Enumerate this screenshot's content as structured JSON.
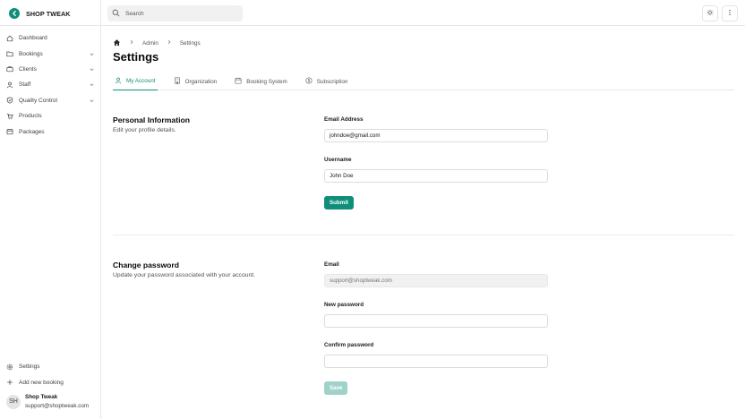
{
  "brand": {
    "name": "SHOP TWEAK"
  },
  "sidebar": {
    "items": [
      {
        "label": "Dashboard",
        "icon": "home-icon",
        "expandable": false
      },
      {
        "label": "Bookings",
        "icon": "folder-icon",
        "expandable": true
      },
      {
        "label": "Clients",
        "icon": "briefcase-icon",
        "expandable": true
      },
      {
        "label": "Staff",
        "icon": "user-icon",
        "expandable": true
      },
      {
        "label": "Quality Control",
        "icon": "shield-icon",
        "expandable": true
      },
      {
        "label": "Products",
        "icon": "cart-icon",
        "expandable": false
      },
      {
        "label": "Packages",
        "icon": "package-icon",
        "expandable": false
      }
    ],
    "bottom": [
      {
        "label": "Settings",
        "icon": "gear-icon"
      },
      {
        "label": "Add new booking",
        "icon": "plus-icon"
      }
    ],
    "user": {
      "initials": "SH",
      "name": "Shop Tweak",
      "email": "support@shoptweak.com"
    }
  },
  "topbar": {
    "search_placeholder": "Search",
    "theme_icon": "sun-icon",
    "more_icon": "kebab-icon"
  },
  "breadcrumb": [
    "Admin",
    "Settings"
  ],
  "page_title": "Settings",
  "tabs": [
    {
      "label": "My Account",
      "icon": "user-icon",
      "active": true
    },
    {
      "label": "Organization",
      "icon": "building-icon",
      "active": false
    },
    {
      "label": "Booking System",
      "icon": "calendar-icon",
      "active": false
    },
    {
      "label": "Subscription",
      "icon": "dollar-icon",
      "active": false
    }
  ],
  "personal": {
    "title": "Personal Information",
    "description": "Edit your profile details.",
    "email_label": "Email Address",
    "email_value": "johndoe@gmail.com",
    "username_label": "Username",
    "username_value": "John Doe",
    "submit_label": "Submit"
  },
  "password": {
    "title": "Change password",
    "description": "Update your password associated with your account.",
    "email_label": "Email",
    "email_placeholder": "support@shoptweak.com",
    "new_label": "New password",
    "confirm_label": "Confirm password",
    "save_label": "Save"
  },
  "colors": {
    "accent": "#0f8f7a",
    "accent_faded": "#9fd3c9"
  }
}
